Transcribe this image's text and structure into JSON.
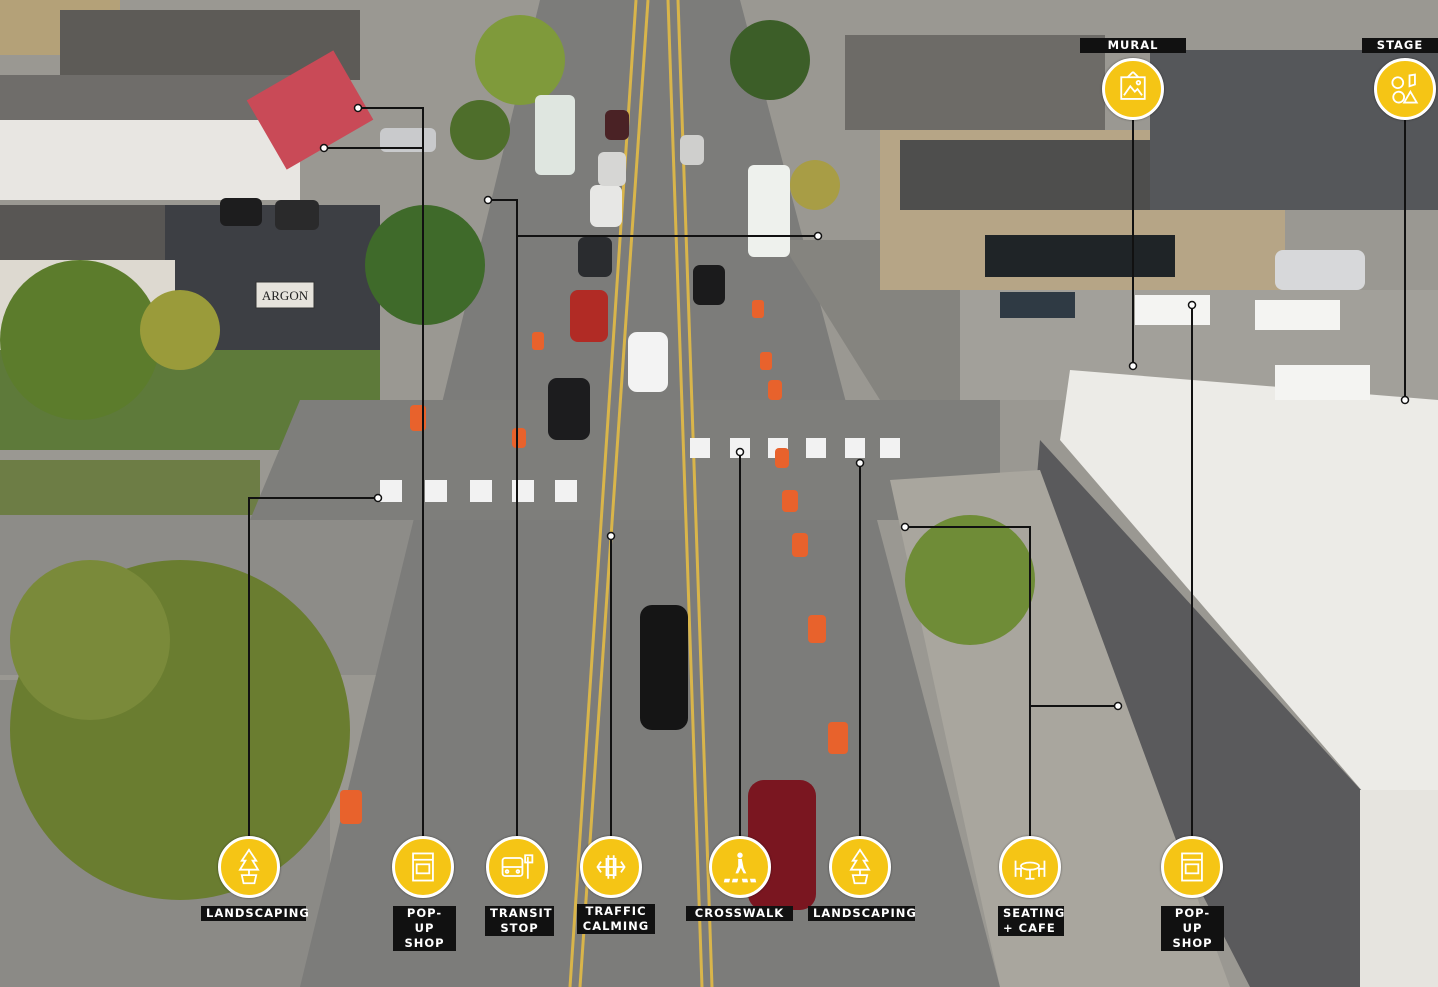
{
  "labels": {
    "mural": "MURAL",
    "stage": "STAGE",
    "landscaping_left": "LANDSCAPING",
    "popup_left": "POP-UP\nSHOP",
    "transit": "TRANSIT\nSTOP",
    "traffic": "TRAFFIC\nCALMING",
    "crosswalk": "CROSSWALK",
    "landscaping_right": "LANDSCAPING",
    "seating": "SEATING\n+ CAFE",
    "popup_right": "POP-UP\nSHOP"
  },
  "icons": {
    "mural": "picture-frame-icon",
    "stage": "music-art-icon",
    "landscaping_left": "tree-icon",
    "popup_left": "kiosk-icon",
    "transit": "bus-stop-icon",
    "traffic": "traffic-calming-icon",
    "crosswalk": "pedestrian-crossing-icon",
    "landscaping_right": "tree-icon",
    "seating": "cafe-table-icon",
    "popup_right": "kiosk-icon"
  },
  "sign_text": "ARGON",
  "colors": {
    "accent": "#f5c515",
    "label_bg": "#111111",
    "line": "#111111"
  }
}
